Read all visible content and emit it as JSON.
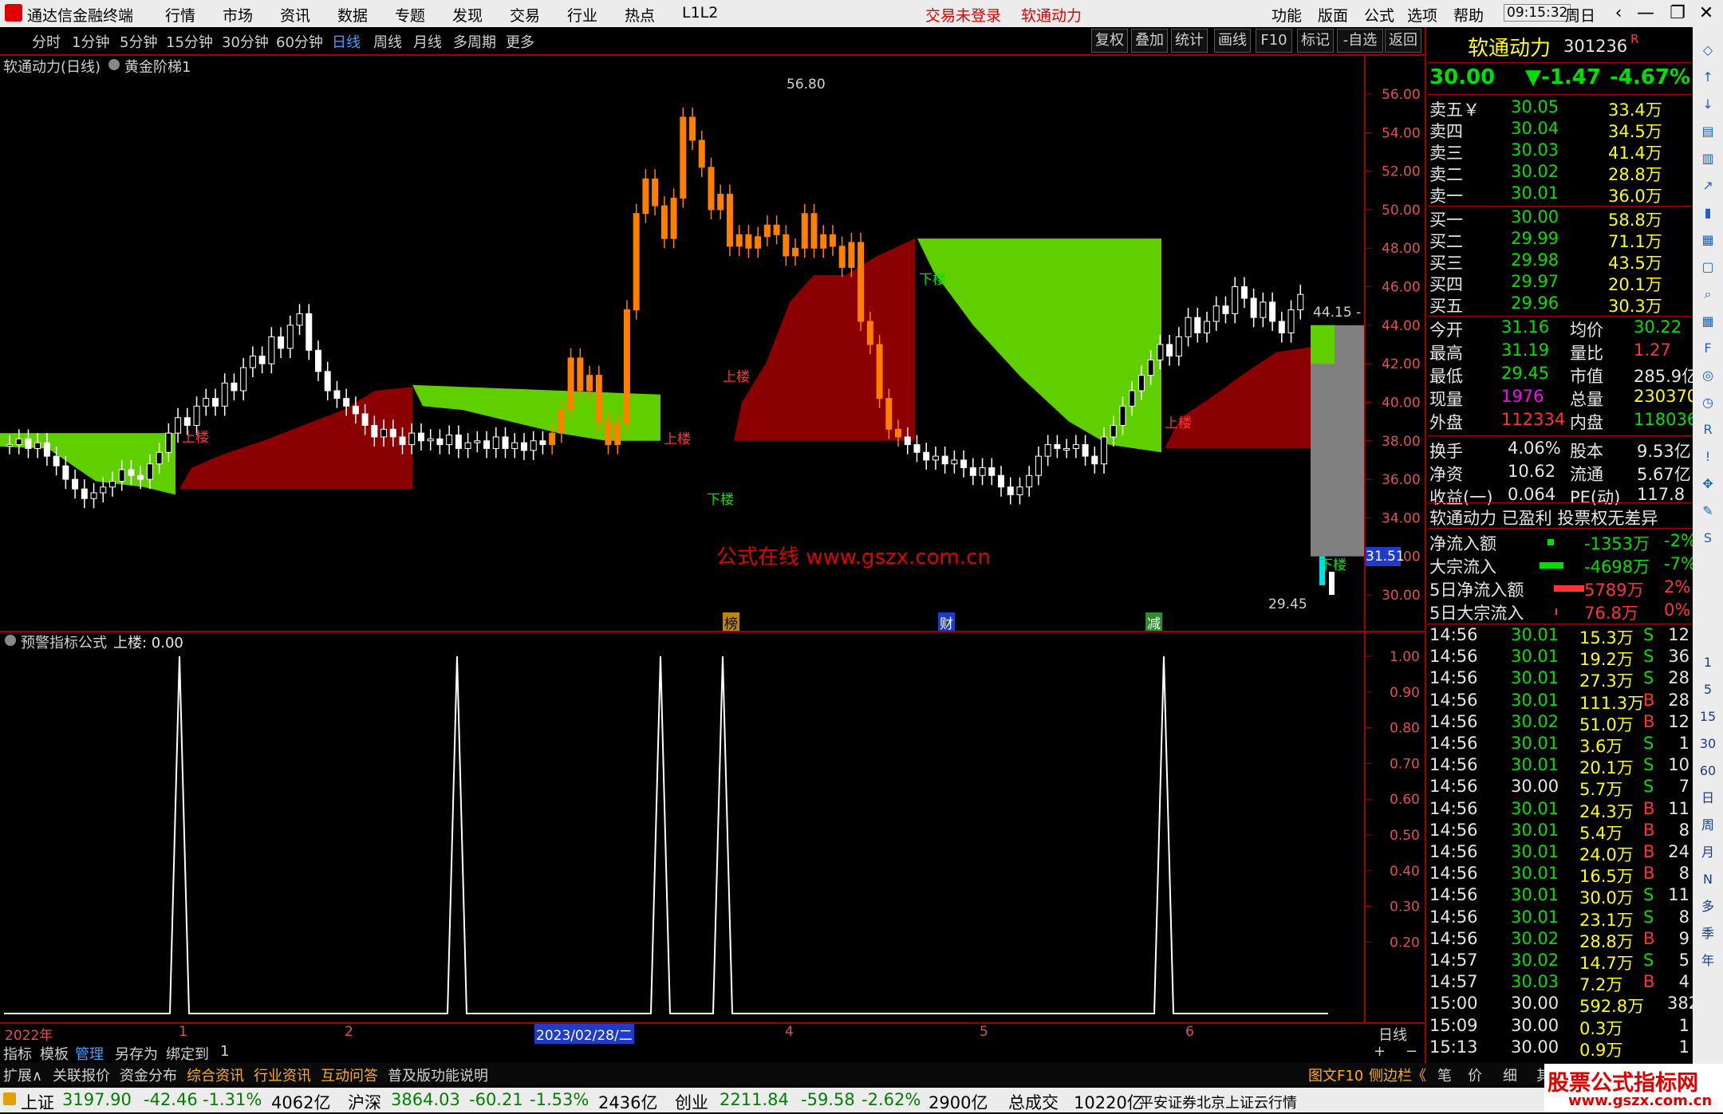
{
  "menubar": {
    "app_title": "通达信金融终端",
    "menus": [
      "行情",
      "市场",
      "资讯",
      "数据",
      "专题",
      "发现",
      "交易",
      "行业",
      "热点",
      "L1L2"
    ],
    "login_status": "交易未登录",
    "stock_name": "软通动力",
    "right_menus": [
      "功能",
      "版面",
      "公式",
      "选项",
      "帮助"
    ],
    "time": "09:15:32",
    "weekday": "周日"
  },
  "periodbar": {
    "periods": [
      "分时",
      "1分钟",
      "5分钟",
      "15分钟",
      "30分钟",
      "60分钟",
      "日线",
      "周线",
      "月线",
      "多周期",
      "更多"
    ],
    "active": "日线",
    "tools": [
      "复权",
      "叠加",
      "统计",
      "画线",
      "F10",
      "标记",
      "-自选",
      "返回"
    ]
  },
  "main_chart": {
    "title": "软通动力(日线)",
    "indicator": "黄金阶梯1",
    "price_axis": [
      "56.00",
      "54.00",
      "52.00",
      "50.00",
      "48.00",
      "46.00",
      "44.00",
      "42.00",
      "40.00",
      "38.00",
      "36.00",
      "34.00",
      "32.00",
      "30.00"
    ],
    "high_label": "56.80",
    "low_label": "29.45",
    "last_label": "44.15 -",
    "current_price_tag": "31.51",
    "watermark": "公式在线  www.gszx.com.cn",
    "event_markers": [
      "榜",
      "财",
      "减"
    ],
    "signal_up": "上楼",
    "signal_down": "下楼"
  },
  "sub_chart": {
    "title": "预警指标公式",
    "value_label": "上楼: 0.00",
    "axis": [
      "1.00",
      "0.90",
      "0.80",
      "0.70",
      "0.60",
      "0.50",
      "0.40",
      "0.30",
      "0.20"
    ]
  },
  "date_axis": {
    "labels": [
      "2022年",
      "1",
      "2",
      "2023/02/28/二",
      "4",
      "5",
      "6"
    ],
    "period": "日线"
  },
  "bottom_tabs": [
    "指标",
    "模板",
    "管理",
    "另存为",
    "绑定到",
    "1"
  ],
  "bottom_links": [
    "扩展∧",
    "关联报价",
    "资金分布",
    "综合资讯",
    "行业资讯",
    "互动问答",
    "普及版功能说明"
  ],
  "bottom_right": [
    "图文F10",
    "侧边栏《",
    "笔",
    "价",
    "细",
    "其"
  ],
  "quote": {
    "name": "软通动力",
    "code": "301236",
    "flag": "R",
    "price": "30.00",
    "change": "▼-1.47",
    "pct": "-4.67%",
    "asks": [
      {
        "label": "卖五￥",
        "price": "30.05",
        "vol": "33.4万"
      },
      {
        "label": "卖四",
        "price": "30.04",
        "vol": "34.5万"
      },
      {
        "label": "卖三",
        "price": "30.03",
        "vol": "41.4万"
      },
      {
        "label": "卖二",
        "price": "30.02",
        "vol": "28.8万"
      },
      {
        "label": "卖一",
        "price": "30.01",
        "vol": "36.0万"
      }
    ],
    "bids": [
      {
        "label": "买一",
        "price": "30.00",
        "vol": "58.8万"
      },
      {
        "label": "买二",
        "price": "29.99",
        "vol": "71.1万"
      },
      {
        "label": "买三",
        "price": "29.98",
        "vol": "43.5万"
      },
      {
        "label": "买四",
        "price": "29.97",
        "vol": "20.1万"
      },
      {
        "label": "买五",
        "price": "29.96",
        "vol": "30.3万"
      }
    ],
    "stats": [
      {
        "k1": "今开",
        "v1": "31.16",
        "k2": "均价",
        "v2": "30.22"
      },
      {
        "k1": "最高",
        "v1": "31.19",
        "k2": "量比",
        "v2": "1.27"
      },
      {
        "k1": "最低",
        "v1": "29.45",
        "k2": "市值",
        "v2": "285.9亿"
      },
      {
        "k1": "现量",
        "v1": "1976",
        "k2": "总量",
        "v2": "230370"
      },
      {
        "k1": "外盘",
        "v1": "112334",
        "k2": "内盘",
        "v2": "118036"
      }
    ],
    "stats2": [
      {
        "k1": "换手",
        "v1": "4.06%",
        "k2": "股本",
        "v2": "9.53亿"
      },
      {
        "k1": "净资",
        "v1": "10.62",
        "k2": "流通",
        "v2": "5.67亿"
      },
      {
        "k1": "收益(一)",
        "v1": "0.064",
        "k2": "PE(动)",
        "v2": "117.8"
      }
    ],
    "tags": "软通动力  已盈利  投票权无差异",
    "flows": [
      {
        "k": "净流入额",
        "v": "-1353万",
        "p": "-2%"
      },
      {
        "k": "大宗流入",
        "v": "-4698万",
        "p": "-7%"
      },
      {
        "k": "5日净流入额",
        "v": "5789万",
        "p": "2%"
      },
      {
        "k": "5日大宗流入",
        "v": "76.8万",
        "p": "0%"
      }
    ],
    "ticks": [
      {
        "t": "14:56",
        "p": "30.01",
        "v": "15.3万",
        "s": "S",
        "n": "12"
      },
      {
        "t": "14:56",
        "p": "30.01",
        "v": "19.2万",
        "s": "S",
        "n": "36"
      },
      {
        "t": "14:56",
        "p": "30.01",
        "v": "27.3万",
        "s": "S",
        "n": "28"
      },
      {
        "t": "14:56",
        "p": "30.01",
        "v": "111.3万",
        "s": "B",
        "n": "28"
      },
      {
        "t": "14:56",
        "p": "30.02",
        "v": "51.0万",
        "s": "B",
        "n": "12"
      },
      {
        "t": "14:56",
        "p": "30.01",
        "v": "3.6万",
        "s": "S",
        "n": "1"
      },
      {
        "t": "14:56",
        "p": "30.01",
        "v": "20.1万",
        "s": "S",
        "n": "10"
      },
      {
        "t": "14:56",
        "p": "30.00",
        "v": "5.7万",
        "s": "S",
        "n": "7"
      },
      {
        "t": "14:56",
        "p": "30.01",
        "v": "24.3万",
        "s": "B",
        "n": "11"
      },
      {
        "t": "14:56",
        "p": "30.01",
        "v": "5.4万",
        "s": "B",
        "n": "8"
      },
      {
        "t": "14:56",
        "p": "30.01",
        "v": "24.0万",
        "s": "B",
        "n": "24"
      },
      {
        "t": "14:56",
        "p": "30.01",
        "v": "16.5万",
        "s": "B",
        "n": "8"
      },
      {
        "t": "14:56",
        "p": "30.01",
        "v": "30.0万",
        "s": "S",
        "n": "11"
      },
      {
        "t": "14:56",
        "p": "30.01",
        "v": "23.1万",
        "s": "S",
        "n": "8"
      },
      {
        "t": "14:56",
        "p": "30.02",
        "v": "28.8万",
        "s": "B",
        "n": "9"
      },
      {
        "t": "14:57",
        "p": "30.02",
        "v": "14.7万",
        "s": "S",
        "n": "5"
      },
      {
        "t": "14:57",
        "p": "30.03",
        "v": "7.2万",
        "s": "B",
        "n": "4"
      },
      {
        "t": "15:00",
        "p": "30.00",
        "v": "592.8万",
        "s": "",
        "n": "382"
      },
      {
        "t": "15:09",
        "p": "30.00",
        "v": "0.3万",
        "s": "",
        "n": "1"
      },
      {
        "t": "15:13",
        "p": "30.00",
        "v": "0.9万",
        "s": "",
        "n": "1"
      }
    ]
  },
  "side_icons": [
    "1",
    "5",
    "15",
    "30",
    "60",
    "日",
    "周",
    "月",
    "N",
    "多",
    "季",
    "年"
  ],
  "statusbar": {
    "items": [
      {
        "name": "上证",
        "val": "3197.90",
        "chg": "-42.46",
        "pct": "-1.31%",
        "amt": "4062亿"
      },
      {
        "name": "沪深",
        "val": "3864.03",
        "chg": "-60.21",
        "pct": "-1.53%",
        "amt": "2436亿"
      },
      {
        "name": "创业",
        "val": "2211.84",
        "chg": "-59.58",
        "pct": "-2.62%",
        "amt": "2900亿"
      }
    ],
    "total_label": "总成交",
    "total": "10220亿",
    "source": "平安证券北京上证云行情",
    "brand": "股票公式指标网",
    "brand_url": "www.gszx.com.cn"
  },
  "colors": {
    "up": "#ff3333",
    "down": "#00e000",
    "ladder_red": "#8b0000",
    "ladder_green": "#5fcf00"
  }
}
